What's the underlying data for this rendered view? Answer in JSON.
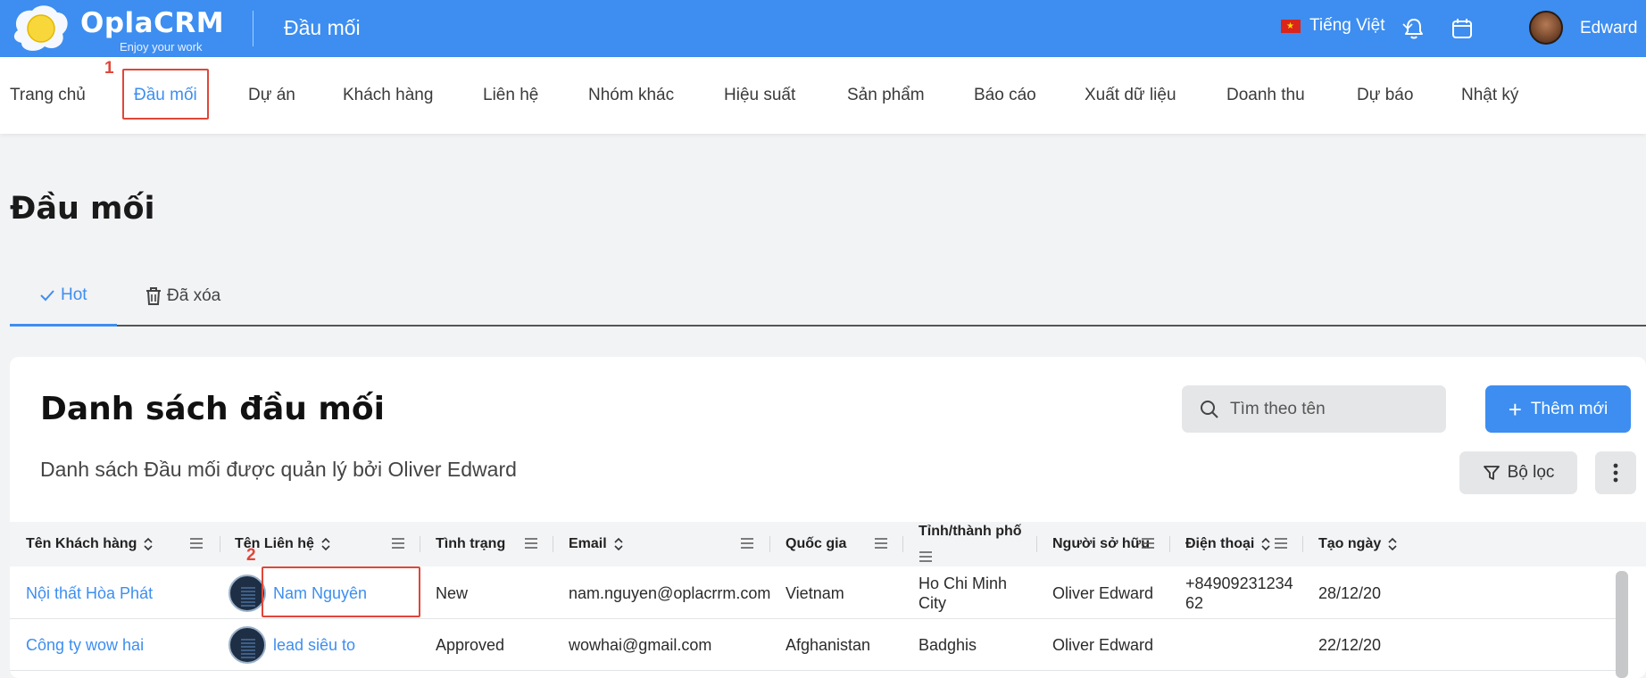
{
  "app": {
    "brand": "OplaCRM",
    "tagline": "Enjoy your work",
    "section_title": "Đầu mối",
    "language": "Tiếng Việt",
    "user_name": "Edward"
  },
  "nav": {
    "items": [
      {
        "label": "Trang chủ"
      },
      {
        "label": "Đầu mối"
      },
      {
        "label": "Dự án"
      },
      {
        "label": "Khách hàng"
      },
      {
        "label": "Liên hệ"
      },
      {
        "label": "Nhóm khác"
      },
      {
        "label": "Hiệu suất"
      },
      {
        "label": "Sản phẩm"
      },
      {
        "label": "Báo cáo"
      },
      {
        "label": "Xuất dữ liệu"
      },
      {
        "label": "Doanh thu"
      },
      {
        "label": "Dự báo"
      },
      {
        "label": "Nhật ký"
      }
    ],
    "active_index": 1
  },
  "annotations": {
    "first": "1",
    "second": "2"
  },
  "page": {
    "title": "Đầu mối",
    "tabs": [
      {
        "label": "Hot"
      },
      {
        "label": "Đã xóa"
      }
    ]
  },
  "card": {
    "title": "Danh sách đầu mối",
    "subtitle": "Danh sách Đầu mối được quản lý bởi Oliver Edward",
    "search_placeholder": "Tìm theo tên",
    "add_label": "Thêm mới",
    "filter_label": "Bộ lọc"
  },
  "table": {
    "columns": [
      {
        "label": "Tên Khách hàng"
      },
      {
        "label": "Tên Liên hệ"
      },
      {
        "label": "Tình trạng"
      },
      {
        "label": "Email"
      },
      {
        "label": "Quốc gia"
      },
      {
        "label": "Tỉnh/thành phố"
      },
      {
        "label": "Người sở hữu"
      },
      {
        "label": "Điện thoại"
      },
      {
        "label": "Tạo ngày"
      }
    ],
    "rows": [
      {
        "customer": "Nội thất Hòa Phát",
        "contact": "Nam Nguyên",
        "status": "New",
        "email": "nam.nguyen@oplacrrm.com",
        "country": "Vietnam",
        "city": "Ho Chi Minh City",
        "owner": "Oliver Edward",
        "phone": "+8490923123462",
        "created": "28/12/20"
      },
      {
        "customer": "Công ty wow hai",
        "contact": "lead siêu to",
        "status": "Approved",
        "email": "wowhai@gmail.com",
        "country": "Afghanistan",
        "city": "Badghis",
        "owner": "Oliver Edward",
        "phone": "",
        "created": "22/12/20"
      }
    ]
  },
  "colors": {
    "brand_blue": "#3d8ef0",
    "annotation_red": "#e0463a"
  }
}
